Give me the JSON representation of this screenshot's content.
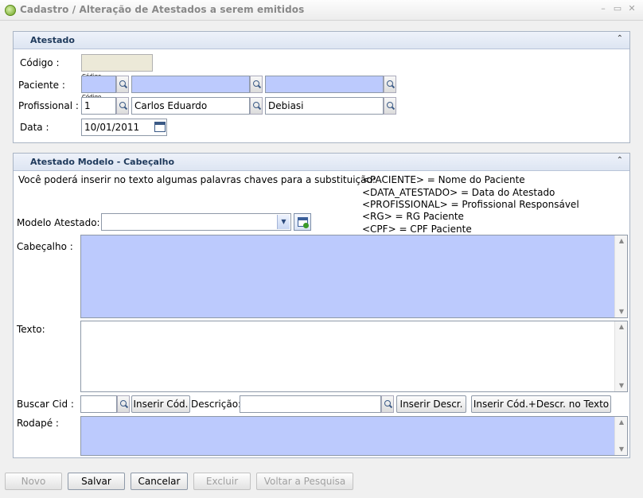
{
  "window": {
    "title": "Cadastro / Alteração de Atestados a serem emitidos",
    "minimize": "–",
    "maximize": "▭",
    "close": "✕"
  },
  "atestado": {
    "title": "Atestado",
    "collapse": "⌃",
    "codigo_label": "Código :",
    "codigo_value": "",
    "paciente_label": "Paciente :",
    "paciente_code_caption": "Código",
    "paciente_code": "",
    "paciente_first": "",
    "paciente_last": "",
    "profissional_label": "Profissional :",
    "profissional_code_caption": "Código",
    "profissional_code": "1",
    "profissional_first": "Carlos Eduardo",
    "profissional_last": "Debiasi",
    "data_label": "Data :",
    "data_value": "10/01/2011"
  },
  "modelo": {
    "title": "Atestado Modelo - Cabeçalho",
    "collapse": "⌃",
    "hint": "Você poderá inserir no texto algumas palavras chaves para a substituição:",
    "keywords": [
      "<PACIENTE> = Nome do Paciente",
      "<DATA_ATESTADO> = Data do Atestado",
      "<PROFISSIONAL> = Profissional Responsável",
      "<RG> = RG Paciente",
      "<CPF> = CPF Paciente"
    ],
    "modelo_label": "Modelo Atestado:",
    "modelo_value": "",
    "combo_arrow": "▼",
    "cabecalho_label": "Cabeçalho :",
    "texto_label": "Texto:",
    "buscar_cid_label": "Buscar Cid :",
    "buscar_cid_value": "",
    "inserir_cod": "Inserir Cód.",
    "descricao_label": "Descrição:",
    "descricao_value": "",
    "inserir_descr": "Inserir Descr.",
    "inserir_cod_descr": "Inserir Cód.+Descr. no Texto",
    "rodape_label": "Rodapé :",
    "scroll_up": "▲",
    "scroll_down": "▼"
  },
  "footer": {
    "novo": "Novo",
    "salvar": "Salvar",
    "cancelar": "Cancelar",
    "excluir": "Excluir",
    "voltar": "Voltar a Pesquisa"
  }
}
